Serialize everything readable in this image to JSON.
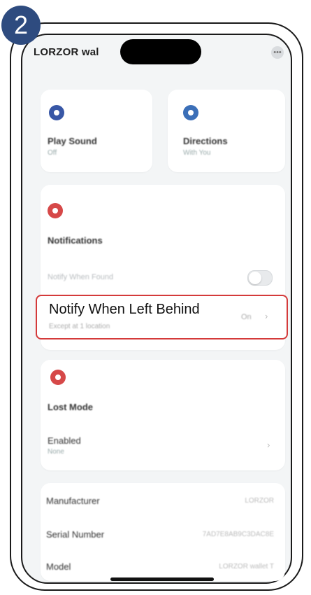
{
  "step_badge": "2",
  "app": {
    "title": "LORZOR wal"
  },
  "cards": {
    "play_sound": {
      "title": "Play Sound",
      "subtitle": "Off"
    },
    "directions": {
      "title": "Directions",
      "subtitle": "With You"
    }
  },
  "notifications": {
    "title": "Notifications",
    "notify_when_found": {
      "label": "Notify When Found"
    },
    "notify_left_behind": {
      "label": "Notify When Left Behind",
      "sublabel": "Except at 1 location",
      "value": "On"
    }
  },
  "lost_mode": {
    "title": "Lost Mode",
    "enabled": {
      "label": "Enabled",
      "value": "None"
    }
  },
  "details": {
    "rows": [
      {
        "label": "Manufacturer",
        "value": "LORZOR"
      },
      {
        "label": "Serial Number",
        "value": "7AD7E8AB9C3DAC8E"
      },
      {
        "label": "Model",
        "value": "LORZOR wallet T"
      }
    ]
  },
  "colors": {
    "accent_blue": "#3857a6",
    "accent_red": "#d64848",
    "highlight": "#d43a3a"
  },
  "icons": {
    "play_sound": "speaker-icon",
    "directions": "compass-icon",
    "notifications": "bell-icon",
    "lost_mode": "lock-icon"
  }
}
